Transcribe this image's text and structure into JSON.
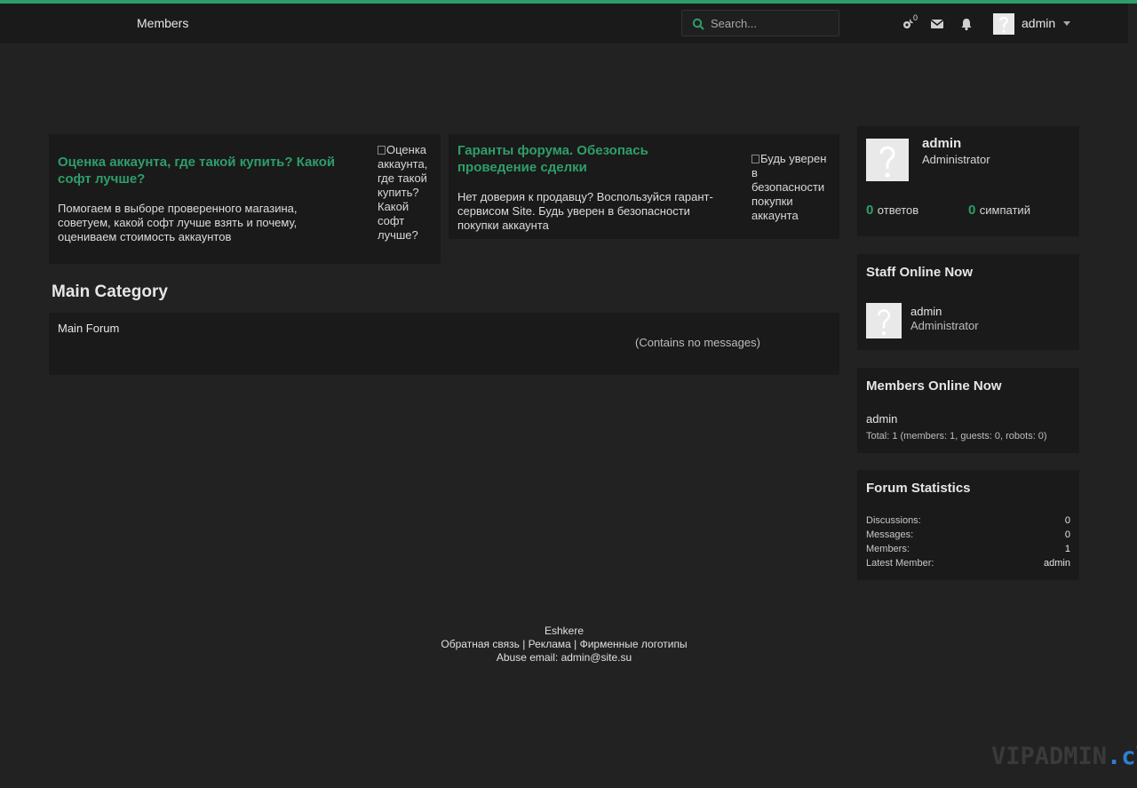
{
  "header": {
    "nav_members": "Members",
    "search_placeholder": "Search...",
    "badge_count": "0",
    "username": "admin",
    "accent_color": "#2e9e6a"
  },
  "promos": [
    {
      "title": "Оценка аккаунта, где такой купить? Какой софт лучше?",
      "description": "Помогаем в выборе проверенного магазина, советуем, какой софт лучше взять и почему, оцениваем стоимость аккаунтов",
      "image_alt": "Оценка аккаунта, где такой купить? Какой софт лучше?"
    },
    {
      "title": "Гаранты форума. Обезопась проведение сделки",
      "description": "Нет доверия к продавцу? Воспользуйся гарант-сервисом Site. Будь уверен в безопасности покупки аккаунта",
      "image_alt": "Будь уверен в безопасности покупки аккаунта"
    }
  ],
  "main": {
    "category_title": "Main Category",
    "forum_name": "Main Forum",
    "forum_empty": "(Contains no messages)"
  },
  "sidebar": {
    "user": {
      "name": "admin",
      "role": "Administrator",
      "replies_count": "0",
      "replies_label": "ответов",
      "likes_count": "0",
      "likes_label": "симпатий"
    },
    "staff_online": {
      "title": "Staff Online Now",
      "name": "admin",
      "role": "Administrator"
    },
    "members_online": {
      "title": "Members Online Now",
      "name": "admin",
      "total": "Total: 1 (members: 1, guests: 0, robots: 0)"
    },
    "forum_stats": {
      "title": "Forum Statistics",
      "rows": [
        {
          "label": "Discussions:",
          "value": "0"
        },
        {
          "label": "Messages:",
          "value": "0"
        },
        {
          "label": "Members:",
          "value": "1"
        },
        {
          "label": "Latest Member:",
          "value": "admin"
        }
      ]
    }
  },
  "footer": {
    "site_name": "Eshkere",
    "link_feedback": "Обратная связь",
    "link_ads": "Реклама",
    "link_logos": "Фирменные логотипы",
    "separator": "|",
    "abuse": "Abuse email: admin@site.su"
  },
  "watermark": {
    "part1": "VIPADMIN",
    "part2": ".club"
  }
}
